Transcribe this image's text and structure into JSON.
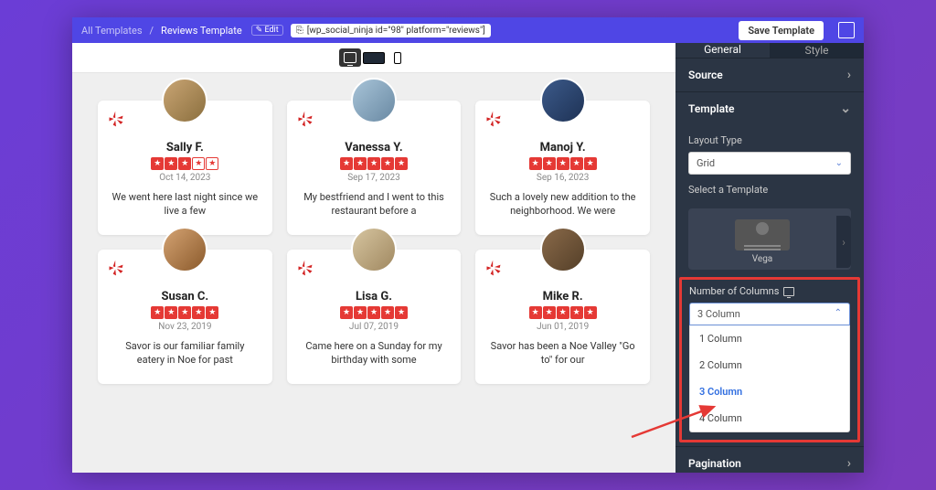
{
  "header": {
    "crumb_root": "All Templates",
    "crumb_current": "Reviews Template",
    "edit": "✎ Edit",
    "shortcode": "[wp_social_ninja id=\"98\" platform=\"reviews\"]",
    "save": "Save Template"
  },
  "reviews": [
    {
      "name": "Sally F.",
      "date": "Oct 14, 2023",
      "stars": 3,
      "text": "We went here last night since we live a few"
    },
    {
      "name": "Vanessa Y.",
      "date": "Sep 17, 2023",
      "stars": 5,
      "text": "My bestfriend and I went to this restaurant before a"
    },
    {
      "name": "Manoj Y.",
      "date": "Sep 16, 2023",
      "stars": 5,
      "text": "Such a lovely new addition to the neighborhood. We were"
    },
    {
      "name": "Susan C.",
      "date": "Nov 23, 2019",
      "stars": 5,
      "text": "Savor is our familiar family eatery in Noe for past"
    },
    {
      "name": "Lisa G.",
      "date": "Jul 07, 2019",
      "stars": 5,
      "text": "Came here on a Sunday for my birthday with some"
    },
    {
      "name": "Mike R.",
      "date": "Jun 01, 2019",
      "stars": 5,
      "text": "Savor has been a Noe Valley \"Go to\" for our"
    }
  ],
  "sidebar": {
    "tab_general": "General",
    "tab_style": "Style",
    "source": "Source",
    "template": "Template",
    "layout_label": "Layout Type",
    "layout_value": "Grid",
    "select_tmpl": "Select a Template",
    "tmpl_name": "Vega",
    "cols_label": "Number of Columns",
    "cols_value": "3 Column",
    "opts": [
      "1 Column",
      "2 Column",
      "3 Column",
      "4 Column"
    ],
    "pagination": "Pagination"
  }
}
